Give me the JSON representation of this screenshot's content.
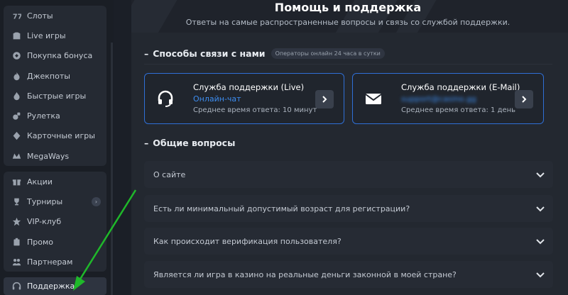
{
  "sidebar": {
    "group1": [
      {
        "label": "Слоты",
        "icon": "slots-icon"
      },
      {
        "label": "Live игры",
        "icon": "live-games-icon"
      },
      {
        "label": "Покупка бонуса",
        "icon": "bonus-buy-icon"
      },
      {
        "label": "Джекпоты",
        "icon": "jackpot-flame-icon"
      },
      {
        "label": "Быстрые игры",
        "icon": "fast-games-icon"
      },
      {
        "label": "Рулетка",
        "icon": "roulette-icon"
      },
      {
        "label": "Карточные игры",
        "icon": "card-games-icon"
      },
      {
        "label": "MegaWays",
        "icon": "megaways-icon"
      }
    ],
    "group2": [
      {
        "label": "Акции",
        "icon": "gift-icon"
      },
      {
        "label": "Турниры",
        "icon": "trophy-icon",
        "badge": "›"
      },
      {
        "label": "VIP-клуб",
        "icon": "star-icon"
      },
      {
        "label": "Промо",
        "icon": "promo-icon"
      },
      {
        "label": "Партнерам",
        "icon": "partners-icon"
      }
    ],
    "support": {
      "label": "Поддержка",
      "icon": "headset-icon"
    }
  },
  "page": {
    "title": "Помощь и поддержка",
    "subtitle": "Ответы на самые распространенные вопросы и связь со службой поддержки."
  },
  "contact": {
    "heading": "Способы связи с нами",
    "badge": "Операторы онлайн 24 часа в сутки",
    "cards": [
      {
        "title": "Служба поддержки (Live)",
        "link": "Онлайн-чат",
        "meta": "Среднее время ответа: 10 минут",
        "icon": "headset-icon"
      },
      {
        "title": "Служба поддержки (E-Mail)",
        "link": "support@casino.gg",
        "meta": "Среднее время ответа: 1 день",
        "icon": "mail-icon"
      }
    ]
  },
  "faq": {
    "heading": "Общие вопросы",
    "items": [
      "О сайте",
      "Есть ли минимальный допустимый возраст для регистрации?",
      "Как происходит верификация пользователя?",
      "Является ли игра в казино на реальные деньги законной в моей стране?"
    ]
  },
  "colors": {
    "accent": "#2f6fd6",
    "link": "#3d8df0",
    "arrow_annotation": "#1fb82a"
  }
}
